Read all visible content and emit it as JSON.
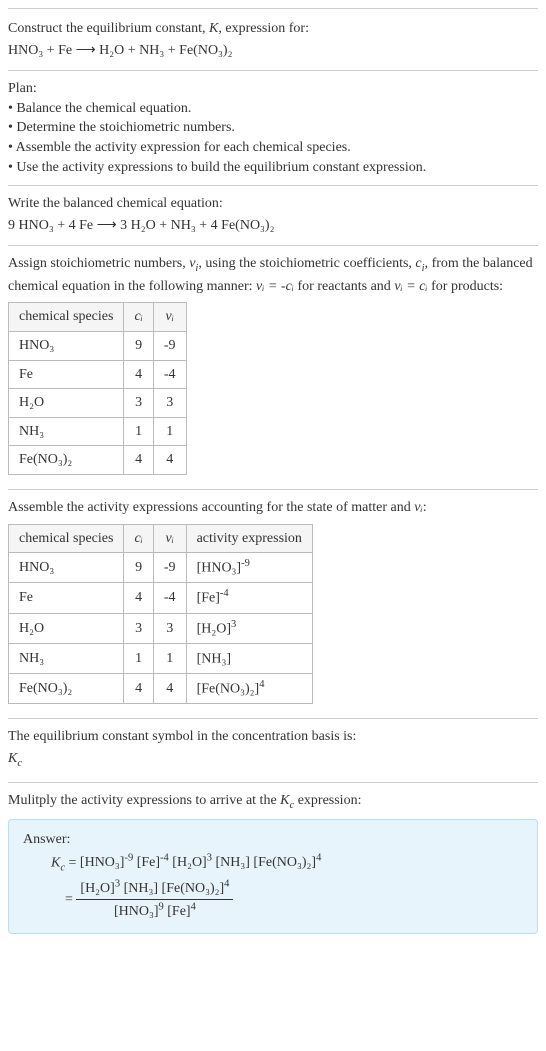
{
  "header": {
    "line1": "Construct the equilibrium constant, ",
    "k_italic": "K",
    "line1b": ", expression for:",
    "equation": "HNO₃ + Fe ⟶ H₂O + NH₃ + Fe(NO₃)₂"
  },
  "plan": {
    "title": "Plan:",
    "items": [
      "• Balance the chemical equation.",
      "• Determine the stoichiometric numbers.",
      "• Assemble the activity expression for each chemical species.",
      "• Use the activity expressions to build the equilibrium constant expression."
    ]
  },
  "balanced": {
    "title": "Write the balanced chemical equation:",
    "equation": "9 HNO₃ + 4 Fe ⟶ 3 H₂O + NH₃ + 4 Fe(NO₃)₂"
  },
  "assign": {
    "text1": "Assign stoichiometric numbers, ",
    "nu": "ν",
    "sub_i": "i",
    "text2": ", using the stoichiometric coefficients, ",
    "c": "c",
    "text3": ", from the balanced chemical equation in the following manner: ",
    "eq1": "νᵢ = -cᵢ",
    "text4": " for reactants and ",
    "eq2": "νᵢ = cᵢ",
    "text5": " for products:"
  },
  "table1": {
    "headers": [
      "chemical species",
      "cᵢ",
      "νᵢ"
    ],
    "rows": [
      [
        "HNO₃",
        "9",
        "-9"
      ],
      [
        "Fe",
        "4",
        "-4"
      ],
      [
        "H₂O",
        "3",
        "3"
      ],
      [
        "NH₃",
        "1",
        "1"
      ],
      [
        "Fe(NO₃)₂",
        "4",
        "4"
      ]
    ]
  },
  "assemble": {
    "text1": "Assemble the activity expressions accounting for the state of matter and ",
    "nu": "νᵢ",
    "text2": ":"
  },
  "table2": {
    "headers": [
      "chemical species",
      "cᵢ",
      "νᵢ",
      "activity expression"
    ],
    "rows": [
      {
        "species": "HNO₃",
        "c": "9",
        "nu": "-9",
        "expr_base": "[HNO₃]",
        "expr_sup": "-9"
      },
      {
        "species": "Fe",
        "c": "4",
        "nu": "-4",
        "expr_base": "[Fe]",
        "expr_sup": "-4"
      },
      {
        "species": "H₂O",
        "c": "3",
        "nu": "3",
        "expr_base": "[H₂O]",
        "expr_sup": "3"
      },
      {
        "species": "NH₃",
        "c": "1",
        "nu": "1",
        "expr_base": "[NH₃]",
        "expr_sup": ""
      },
      {
        "species": "Fe(NO₃)₂",
        "c": "4",
        "nu": "4",
        "expr_base": "[Fe(NO₃)₂]",
        "expr_sup": "4"
      }
    ]
  },
  "eqconst": {
    "line1": "The equilibrium constant symbol in the concentration basis is:",
    "symbol": "K",
    "sub": "c"
  },
  "multiply": {
    "text": "Mulitply the activity expressions to arrive at the ",
    "k": "K",
    "sub": "c",
    "text2": " expression:"
  },
  "answer": {
    "label": "Answer:",
    "k": "K",
    "sub": "c",
    "eq_prefix": " = ",
    "line1_parts": [
      {
        "base": "[HNO₃]",
        "sup": "-9"
      },
      {
        "base": " [Fe]",
        "sup": "-4"
      },
      {
        "base": " [H₂O]",
        "sup": "3"
      },
      {
        "base": " [NH₃]",
        "sup": ""
      },
      {
        "base": " [Fe(NO₃)₂]",
        "sup": "4"
      }
    ],
    "frac_eq": " = ",
    "num_parts": [
      {
        "base": "[H₂O]",
        "sup": "3"
      },
      {
        "base": " [NH₃]",
        "sup": ""
      },
      {
        "base": " [Fe(NO₃)₂]",
        "sup": "4"
      }
    ],
    "den_parts": [
      {
        "base": "[HNO₃]",
        "sup": "9"
      },
      {
        "base": " [Fe]",
        "sup": "4"
      }
    ]
  }
}
